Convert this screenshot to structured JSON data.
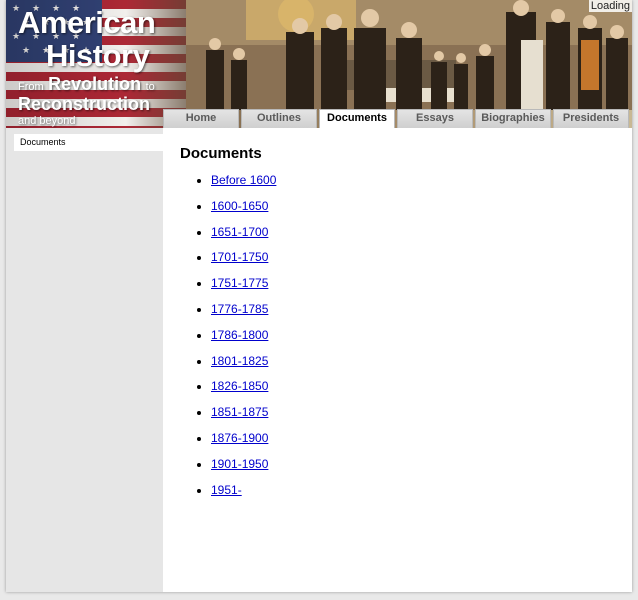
{
  "banner": {
    "title_line1": "American",
    "title_line2": "History",
    "sub_from": "From",
    "sub_revolution": "Revolution",
    "sub_to": "to",
    "sub_reconstruction": "Reconstruction",
    "sub_beyond": "and beyond",
    "loading": "Loading"
  },
  "tabs": [
    {
      "label": "Home"
    },
    {
      "label": "Outlines"
    },
    {
      "label": "Documents"
    },
    {
      "label": "Essays"
    },
    {
      "label": "Biographies"
    },
    {
      "label": "Presidents"
    }
  ],
  "sidebar": {
    "items": [
      {
        "label": "Documents"
      }
    ]
  },
  "main": {
    "heading": "Documents",
    "links": [
      "Before 1600",
      "1600-1650",
      "1651-1700",
      "1701-1750",
      "1751-1775",
      "1776-1785",
      "1786-1800",
      "1801-1825",
      "1826-1850",
      "1851-1875",
      "1876-1900",
      "1901-1950",
      "1951-"
    ]
  },
  "colors": {
    "link": "#0000cc",
    "flag_red": "#b22234",
    "flag_blue": "#2a3f7a"
  }
}
